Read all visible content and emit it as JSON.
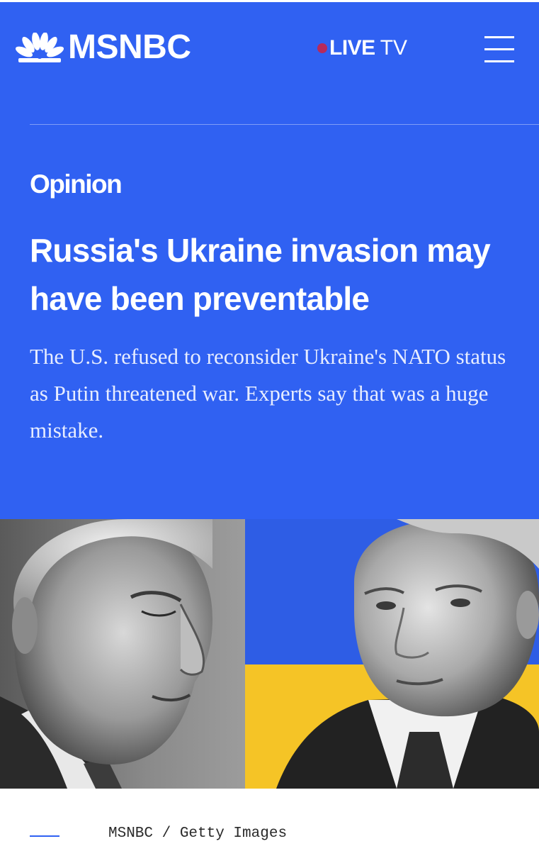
{
  "header": {
    "logo_text": "MSNBC",
    "live_bold": "LIVE",
    "live_thin": "TV",
    "menu_icon": "hamburger-menu-icon"
  },
  "article": {
    "kicker": "Opinion",
    "headline": "Russia's Ukraine invasion may have been preventable",
    "dek": "The U.S. refused to reconsider Ukraine's NATO status as Putin threatened war. Experts say that was a huge mistake."
  },
  "image": {
    "credit": "MSNBC / Getty Images"
  },
  "colors": {
    "brand_blue": "#3061f2",
    "live_dot": "#b72a5c",
    "flag_blue": "#2e5de5",
    "flag_yellow": "#f5c426"
  }
}
